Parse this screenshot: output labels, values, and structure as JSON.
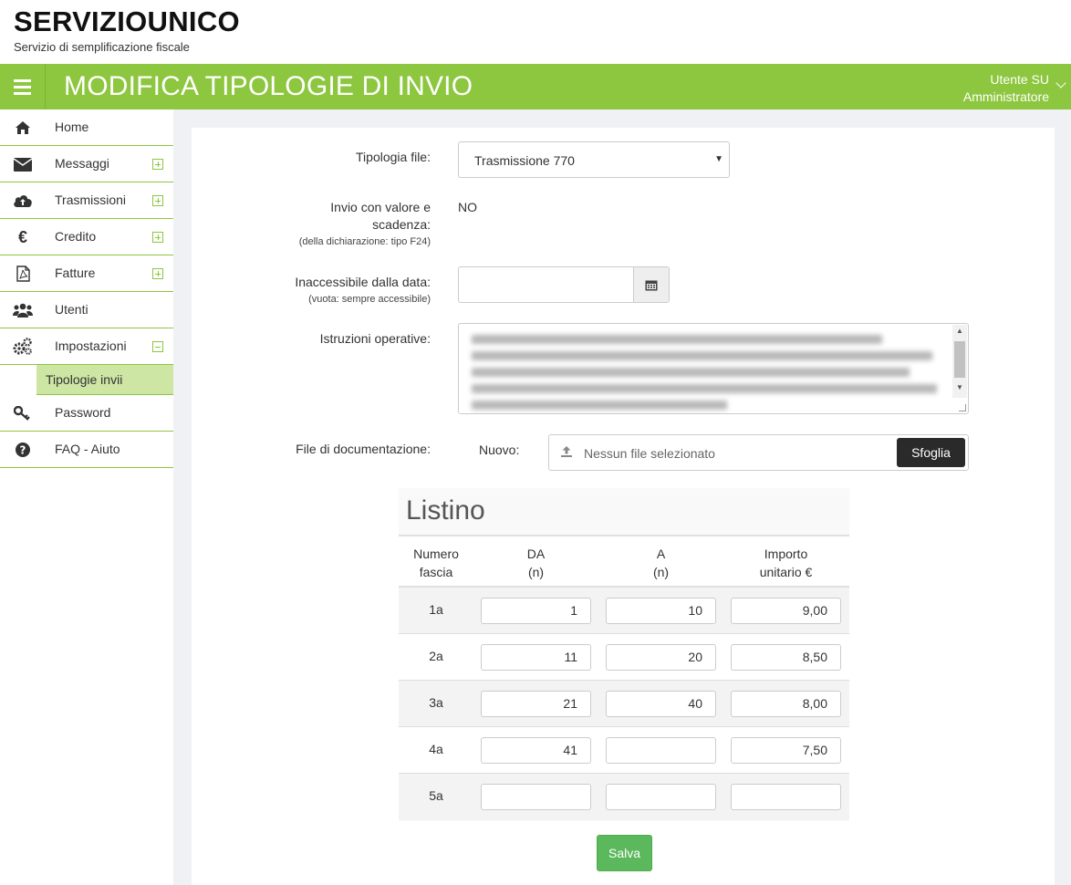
{
  "brand": {
    "title": "SERVIZIOUNICO",
    "subtitle": "Servizio di semplificazione fiscale"
  },
  "header": {
    "page_title": "MODIFICA TIPOLOGIE DI INVIO",
    "user_name": "Utente SU",
    "user_role": "Amministratore"
  },
  "sidebar": {
    "items": [
      {
        "label": "Home",
        "icon": "home-icon"
      },
      {
        "label": "Messaggi",
        "icon": "envelope-icon"
      },
      {
        "label": "Trasmissioni",
        "icon": "cloud-upload-icon"
      },
      {
        "label": "Credito",
        "icon": "euro-icon"
      },
      {
        "label": "Fatture",
        "icon": "pdf-icon"
      },
      {
        "label": "Utenti",
        "icon": "users-icon"
      },
      {
        "label": "Impostazioni",
        "icon": "gears-icon"
      },
      {
        "label": "Password",
        "icon": "key-icon"
      },
      {
        "label": "FAQ - Aiuto",
        "icon": "question-icon"
      }
    ],
    "sub_items": [
      {
        "label": "Tipologie invii"
      }
    ]
  },
  "form": {
    "tipologia_label": "Tipologia file:",
    "tipologia_value": "Trasmissione 770",
    "invio_label_1": "Invio con valore e",
    "invio_label_2": "scadenza:",
    "invio_note": "(della dichiarazione: tipo F24)",
    "invio_value": "NO",
    "inaccessibile_label": "Inaccessibile dalla data:",
    "inaccessibile_note": "(vuota: sempre accessibile)",
    "istruzioni_label": "Istruzioni operative:",
    "file_label": "File di documentazione:",
    "nuovo_label": "Nuovo:",
    "file_placeholder": "Nessun file selezionato",
    "browse_label": "Sfoglia"
  },
  "listino": {
    "title": "Listino",
    "headers": {
      "numero_1": "Numero",
      "numero_2": "fascia",
      "da_1": "DA",
      "da_2": "(n)",
      "a_1": "A",
      "a_2": "(n)",
      "importo_1": "Importo",
      "importo_2": "unitario €"
    },
    "rows": [
      {
        "fascia": "1a",
        "da": "1",
        "a": "10",
        "importo": "9,00"
      },
      {
        "fascia": "2a",
        "da": "11",
        "a": "20",
        "importo": "8,50"
      },
      {
        "fascia": "3a",
        "da": "21",
        "a": "40",
        "importo": "8,00"
      },
      {
        "fascia": "4a",
        "da": "41",
        "a": "",
        "importo": "7,50"
      },
      {
        "fascia": "5a",
        "da": "",
        "a": "",
        "importo": ""
      }
    ]
  },
  "actions": {
    "save_label": "Salva"
  },
  "colors": {
    "brand_green": "#8dc63f",
    "active_sub_bg": "#cde6a3",
    "save_green": "#5cb85c",
    "browse_dark": "#2a2a2a"
  }
}
